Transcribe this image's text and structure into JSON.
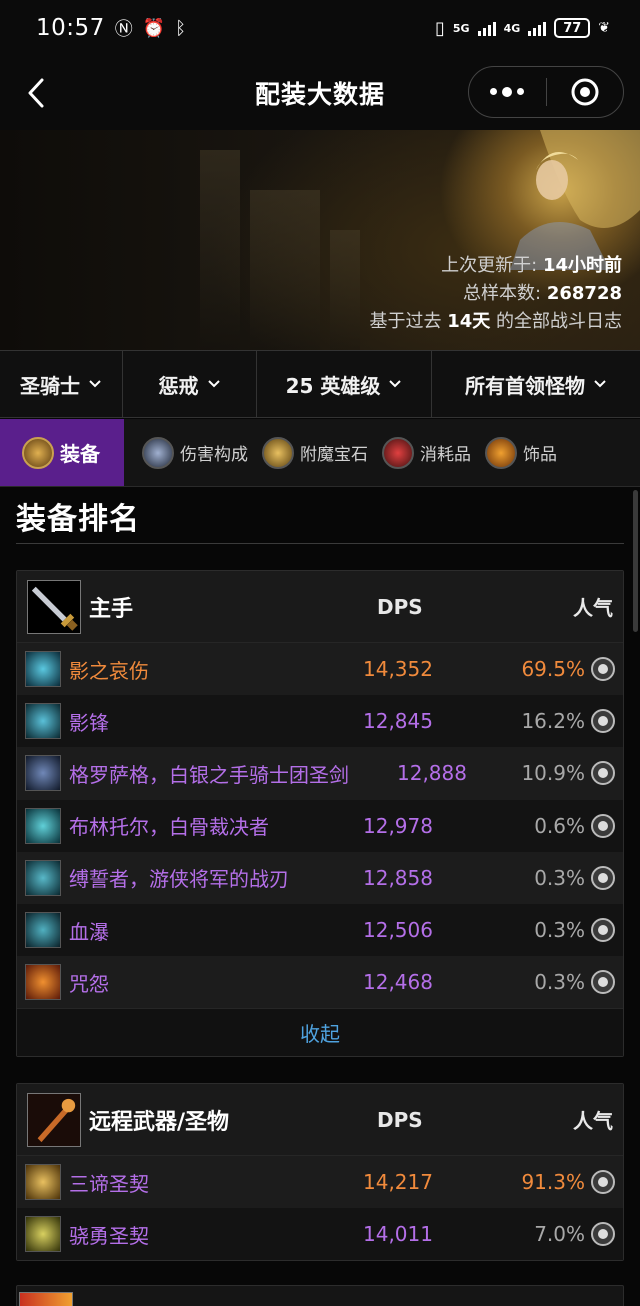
{
  "status_bar": {
    "time": "10:57",
    "network": "5G",
    "network2": "4G",
    "battery": "77"
  },
  "nav": {
    "title": "配装大数据"
  },
  "banner": {
    "updated_label": "上次更新于:",
    "updated_value": "14小时前",
    "samples_label": "总样本数:",
    "samples_value": "268728",
    "basis_prefix": "基于过去",
    "basis_days": "14天",
    "basis_suffix": "的全部战斗日志"
  },
  "filters": [
    {
      "label": "圣骑士"
    },
    {
      "label": "惩戒"
    },
    {
      "label": "25 英雄级"
    },
    {
      "label": "所有首领怪物"
    }
  ],
  "tabs": [
    {
      "label": "装备",
      "icon": "armor-icon",
      "color": "#b8862e"
    },
    {
      "label": "伤害构成",
      "icon": "sword-icon",
      "color": "#8090b0"
    },
    {
      "label": "附魔宝石",
      "icon": "scroll-icon",
      "color": "#c8a040"
    },
    {
      "label": "消耗品",
      "icon": "potion-icon",
      "color": "#c03030"
    },
    {
      "label": "饰品",
      "icon": "trinket-icon",
      "color": "#e09020"
    }
  ],
  "section": {
    "title": "装备排名"
  },
  "colors": {
    "accent_purple": "#5a1f8c",
    "epic": "#b46fe8",
    "legendary": "#f08a3c",
    "link": "#4fa3e0"
  },
  "cards": [
    {
      "slot": "主手",
      "dps_header": "DPS",
      "pop_header": "人气",
      "collapse_label": "收起",
      "items": [
        {
          "name": "影之哀伤",
          "dps": "14,352",
          "popularity": "69.5%",
          "quality": "legendary"
        },
        {
          "name": "影锋",
          "dps": "12,845",
          "popularity": "16.2%",
          "quality": "epic"
        },
        {
          "name": "格罗萨格，白银之手骑士团圣剑",
          "dps": "12,888",
          "popularity": "10.9%",
          "quality": "epic"
        },
        {
          "name": "布林托尔，白骨裁决者",
          "dps": "12,978",
          "popularity": "0.6%",
          "quality": "epic"
        },
        {
          "name": "缚誓者，游侠将军的战刃",
          "dps": "12,858",
          "popularity": "0.3%",
          "quality": "epic"
        },
        {
          "name": "血瀑",
          "dps": "12,506",
          "popularity": "0.3%",
          "quality": "epic"
        },
        {
          "name": "咒怨",
          "dps": "12,468",
          "popularity": "0.3%",
          "quality": "epic"
        }
      ]
    },
    {
      "slot": "远程武器/圣物",
      "dps_header": "DPS",
      "pop_header": "人气",
      "items": [
        {
          "name": "三谛圣契",
          "dps": "14,217",
          "popularity": "91.3%",
          "quality": "legendary_pop"
        },
        {
          "name": "骁勇圣契",
          "dps": "14,011",
          "popularity": "7.0%",
          "quality": "epic"
        }
      ]
    }
  ]
}
